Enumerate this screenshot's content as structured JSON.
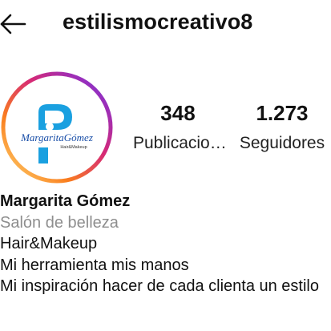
{
  "header": {
    "username": "estilismocreativo8",
    "back_icon": "arrow-left-icon"
  },
  "profile": {
    "avatar": {
      "logo_text": "MargaritaGómez",
      "logo_subtext": "Hair&Makeup",
      "ring_colors": [
        "#feda75",
        "#fa7e1e",
        "#d62976",
        "#962fbf",
        "#4f5bd5"
      ],
      "logo_color": "#1aa0e0"
    },
    "stats": {
      "posts": {
        "count": "348",
        "label": "Publicacio…"
      },
      "followers": {
        "count": "1.273",
        "label": "Seguidores"
      }
    }
  },
  "bio": {
    "name": "Margarita Gómez",
    "category": "Salón de belleza",
    "lines": [
      "Hair&Makeup",
      "Mi herramienta mis manos",
      "Mi inspiración hacer de cada clienta un estilo"
    ]
  }
}
